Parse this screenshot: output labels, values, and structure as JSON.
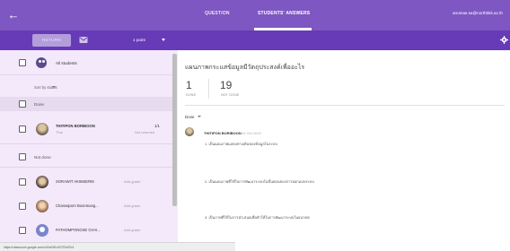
{
  "topbar": {
    "tabs": [
      {
        "label": "QUESTION"
      },
      {
        "label": "STUDENTS' ANSWERS"
      }
    ],
    "account": "anumas.sa@northbkk.ac.th",
    "accent_color": "#7e57c2"
  },
  "actionbar": {
    "return_label": "RETURN",
    "points_value": "1 point",
    "icons": [
      "mail-icon",
      "settings-icon"
    ]
  },
  "left_panel": {
    "all_students_label": "All students",
    "sort_label": "Sort by status",
    "done_header": "Done",
    "done_student": {
      "name": "THITIPON BORIBOON",
      "sub": "Thai",
      "score": "1/1",
      "status": "Not returned"
    },
    "not_done_header": "Not done",
    "not_done_students": [
      {
        "name": "SORAWIT AKIMSERM",
        "grade_placeholder": "Add grade"
      },
      {
        "name": "Chamaiporn Boonmang...",
        "grade_placeholder": "Add grade"
      },
      {
        "name": "PATHOMPONGSE CHAI...",
        "grade_placeholder": "Add grade"
      }
    ]
  },
  "right_panel": {
    "title": "แผนภาพกระแสข้อมูลมีวัตถุประสงค์เพื่ออะไร",
    "done_count": "1",
    "done_label": "DONE",
    "not_done_count": "19",
    "not_done_label": "NOT DONE",
    "filter_label": "Done",
    "response": {
      "name": "THITIPON BORIBOON",
      "time": "14 Oct 2019",
      "answers": [
        "1. เป็นแผนภาพแสดงทางเดินของข้อมูลในระบบ",
        "2. เป็นแผนภาพที่ใช้ในการพัฒนาระบบในขั้นตอนของการออกแบบระบบ",
        "3. เป็นภาพที่ใช้ในการนำเสนอเพื่อทำให้ในการพัฒนาระบบในอนาคต"
      ]
    }
  },
  "status_url": "https://classroom.google.com/u/0/c/NDc3OTEzNTc4"
}
